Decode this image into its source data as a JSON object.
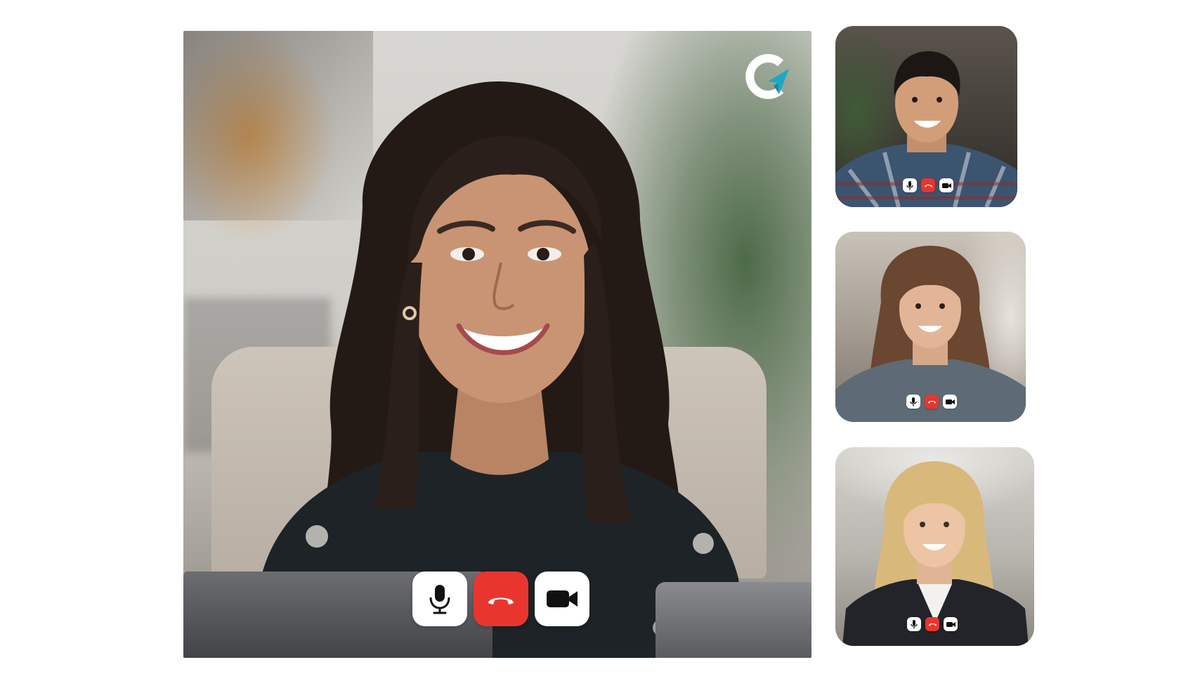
{
  "app": {
    "brand_logo": "c-arrow-logo",
    "accent_color": "#1ea7c4",
    "end_call_color": "#e8362f"
  },
  "main_video": {
    "participant_type": "woman-dark-hair-smiling",
    "controls": {
      "mic_icon": "microphone-icon",
      "end_call_icon": "phone-hangup-icon",
      "camera_icon": "video-camera-icon"
    }
  },
  "participants": [
    {
      "participant_type": "man-plaid-shirt-smiling",
      "controls": [
        "microphone-icon",
        "phone-hangup-icon",
        "video-camera-icon"
      ]
    },
    {
      "participant_type": "woman-brown-hair-smiling",
      "controls": [
        "microphone-icon",
        "phone-hangup-icon",
        "video-camera-icon"
      ]
    },
    {
      "participant_type": "woman-blonde-hair-blazer",
      "controls": [
        "microphone-icon",
        "phone-hangup-icon",
        "video-camera-icon"
      ]
    }
  ]
}
